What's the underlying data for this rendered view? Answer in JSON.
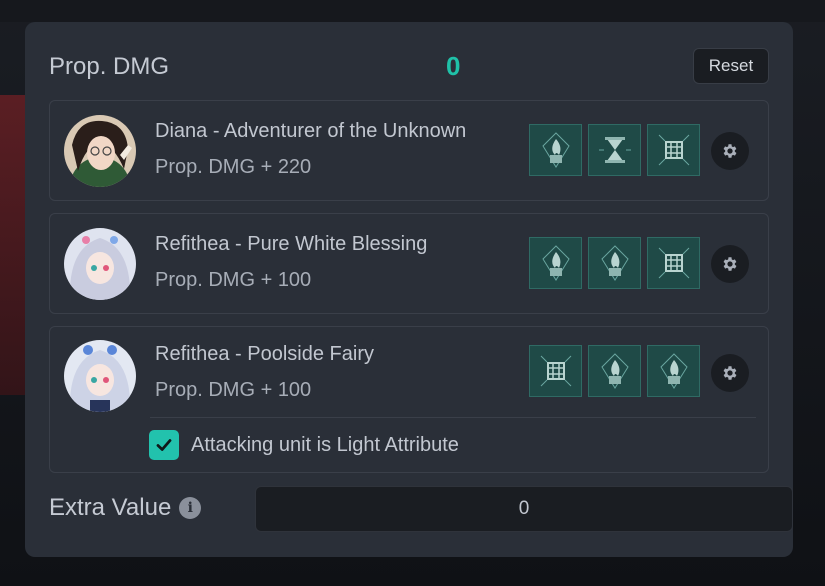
{
  "header": {
    "title": "Prop. DMG",
    "total": "0",
    "reset_label": "Reset"
  },
  "cards": [
    {
      "name": "Diana - Adventurer of the Unknown",
      "value": "Prop. DMG + 220",
      "skills": [
        "flame-skill-icon",
        "hourglass-skill-icon",
        "grid-skill-icon"
      ]
    },
    {
      "name": "Refithea - Pure White Blessing",
      "value": "Prop. DMG + 100",
      "skills": [
        "flame-skill-icon",
        "flame-skill-icon",
        "grid-skill-icon"
      ]
    },
    {
      "name": "Refithea - Poolside Fairy",
      "value": "Prop. DMG + 100",
      "skills": [
        "grid-skill-icon",
        "flame-skill-icon",
        "flame-skill-icon"
      ],
      "condition": {
        "label": "Attacking unit is Light Attribute",
        "checked": true
      }
    }
  ],
  "extra": {
    "label": "Extra Value",
    "value": "0"
  },
  "colors": {
    "accent": "#1fc1a8",
    "panel": "#2a2f38",
    "skill_bg": "#1f4a47"
  }
}
